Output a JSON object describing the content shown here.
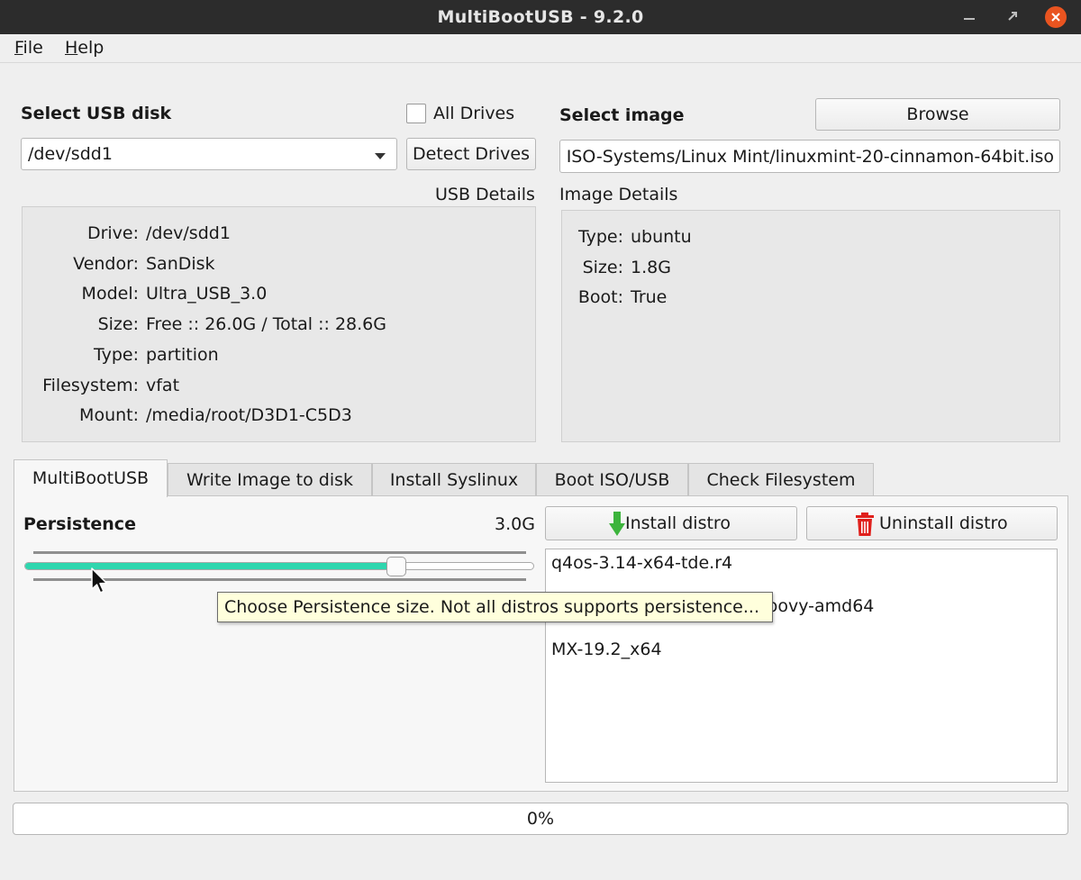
{
  "window": {
    "title": "MultiBootUSB - 9.2.0"
  },
  "menu": {
    "file": "File",
    "file_rest": "ile",
    "file_key": "F",
    "help": "Help",
    "help_key": "H",
    "help_rest": "elp"
  },
  "usb": {
    "heading": "Select USB disk",
    "all_drives_label": "All Drives",
    "all_drives_checked": false,
    "selected_disk": "/dev/sdd1",
    "detect_button": "Detect Drives",
    "details_label": "USB Details",
    "details": [
      {
        "key": "Drive:",
        "value": "/dev/sdd1"
      },
      {
        "key": "Vendor:",
        "value": "SanDisk"
      },
      {
        "key": "Model:",
        "value": "Ultra_USB_3.0"
      },
      {
        "key": "Size:",
        "value": "Free :: 26.0G / Total :: 28.6G"
      },
      {
        "key": "Type:",
        "value": "partition"
      },
      {
        "key": "Filesystem:",
        "value": "vfat"
      },
      {
        "key": "Mount:",
        "value": "/media/root/D3D1-C5D3"
      }
    ]
  },
  "image": {
    "heading": "Select image",
    "browse_button": "Browse",
    "path": "ISO-Systems/Linux Mint/linuxmint-20-cinnamon-64bit.iso",
    "details_label": "Image Details",
    "details": [
      {
        "key": "Type:",
        "value": "ubuntu"
      },
      {
        "key": "Size:",
        "value": "1.8G"
      },
      {
        "key": "Boot:",
        "value": "True"
      }
    ]
  },
  "tabs": [
    {
      "label": "MultiBootUSB",
      "active": true
    },
    {
      "label": "Write Image to disk",
      "active": false
    },
    {
      "label": "Install Syslinux",
      "active": false
    },
    {
      "label": "Boot ISO/USB",
      "active": false
    },
    {
      "label": "Check Filesystem",
      "active": false
    }
  ],
  "persistence": {
    "label": "Persistence",
    "value_text": "3.0G",
    "slider_fraction": 0.73,
    "tooltip": "Choose Persistence size. Not all distros supports persistence..."
  },
  "actions": {
    "install": "Install distro",
    "uninstall": "Uninstall distro"
  },
  "distros": [
    "q4os-3.14-x64-tde.r4",
    "groovy-amd64",
    "MX-19.2_x64"
  ],
  "progress": {
    "value": 0,
    "text": "0%"
  },
  "colors": {
    "titlebar": "#2c2c2c",
    "close": "#e95420",
    "slider_fill": "#2ed6ae",
    "install_arrow": "#3cb43c",
    "trash": "#e0201c",
    "tooltip_bg": "#ffffdc"
  },
  "icons": [
    "minimize-icon",
    "maximize-icon",
    "close-icon",
    "chevron-down-icon",
    "download-arrow-icon",
    "trash-icon",
    "mouse-cursor-icon"
  ]
}
